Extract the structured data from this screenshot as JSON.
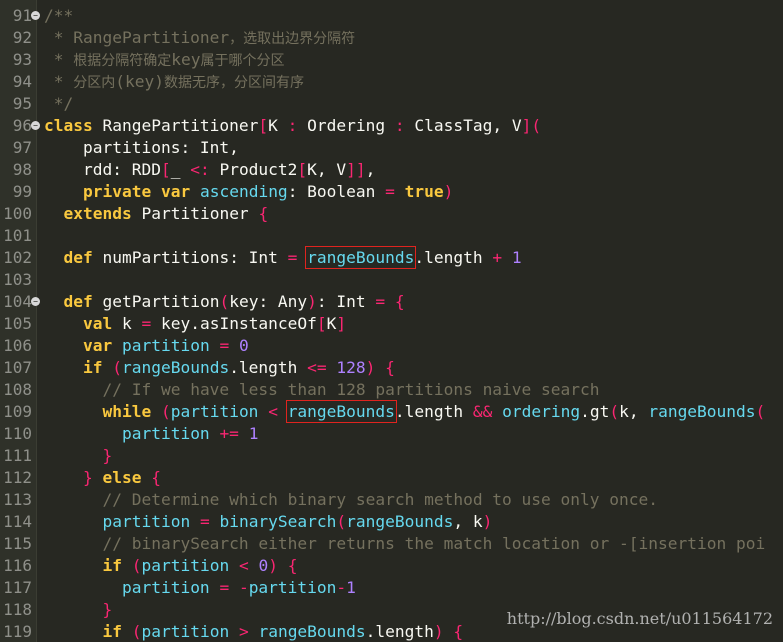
{
  "lines": [
    {
      "n": "91",
      "fold": true,
      "html": "<span class=\"cm\">/**</span>"
    },
    {
      "n": "92",
      "html": "<span class=\"cm\"> * RangePartitioner<span class=\"zh\">，选取出边界分隔符</span></span>"
    },
    {
      "n": "93",
      "html": "<span class=\"cm\"> * <span class=\"zh\">根据分隔符确定</span>key<span class=\"zh\">属于哪个分区</span></span>"
    },
    {
      "n": "94",
      "html": "<span class=\"cm\"> * <span class=\"zh\">分区内</span>(key)<span class=\"zh\">数据无序，分区间有序</span></span>"
    },
    {
      "n": "95",
      "html": "<span class=\"cm\"> */</span>"
    },
    {
      "n": "96",
      "fold": true,
      "html": "<span class=\"kw\">class</span> RangePartitioner<span class=\"op\">[</span>K <span class=\"op\">:</span> Ordering <span class=\"op\">:</span> ClassTag, V<span class=\"op\">](</span>"
    },
    {
      "n": "97",
      "html": "    partitions: Int,"
    },
    {
      "n": "98",
      "html": "    rdd: RDD<span class=\"op\">[</span>_ <span class=\"op\">&lt;:</span> Product2<span class=\"op\">[</span>K, V<span class=\"op\">]]</span>,"
    },
    {
      "n": "99",
      "html": "    <span class=\"kw\">private</span> <span class=\"kw\">var</span> <span class=\"id\">ascending</span>: Boolean <span class=\"op\">=</span> <span class=\"kw\">true</span><span class=\"op\">)</span>"
    },
    {
      "n": "100",
      "html": "  <span class=\"kw\">extends</span> Partitioner <span class=\"op\">{</span>"
    },
    {
      "n": "101",
      "html": ""
    },
    {
      "n": "102",
      "html": "  <span class=\"kw\">def</span> numPartitions: Int <span class=\"op\">=</span> <span class=\"id hl\" data-name=\"highlighted-rangeBounds\">rangeBounds</span>.length <span class=\"op\">+</span> <span class=\"num\">1</span>"
    },
    {
      "n": "103",
      "html": ""
    },
    {
      "n": "104",
      "fold": true,
      "html": "  <span class=\"kw\">def</span> getPartition<span class=\"op\">(</span>key: Any<span class=\"op\">)</span>: Int <span class=\"op\">= {</span>"
    },
    {
      "n": "105",
      "html": "    <span class=\"kw\">val</span> k <span class=\"op\">=</span> key.asInstanceOf<span class=\"op\">[</span>K<span class=\"op\">]</span>"
    },
    {
      "n": "106",
      "html": "    <span class=\"kw\">var</span> <span class=\"id\">partition</span> <span class=\"op\">=</span> <span class=\"num\">0</span>"
    },
    {
      "n": "107",
      "html": "    <span class=\"kw\">if</span> <span class=\"op\">(</span><span class=\"id\">rangeBounds</span>.length <span class=\"op\">&lt;=</span> <span class=\"num\">128</span><span class=\"op\">) {</span>"
    },
    {
      "n": "108",
      "html": "      <span class=\"cm\">// If we have less than 128 partitions naive search</span>"
    },
    {
      "n": "109",
      "html": "      <span class=\"kw\">while</span> <span class=\"op\">(</span><span class=\"id\">partition</span> <span class=\"op\">&lt;</span> <span class=\"id hl\" data-name=\"highlighted-rangeBounds\">rangeBounds</span>.length <span class=\"op\">&amp;&amp;</span> <span class=\"id\">ordering</span>.gt<span class=\"op\">(</span>k, <span class=\"id\">rangeBounds</span><span class=\"op\">(</span>"
    },
    {
      "n": "110",
      "html": "        <span class=\"id\">partition</span> <span class=\"op\">+=</span> <span class=\"num\">1</span>"
    },
    {
      "n": "111",
      "html": "      <span class=\"op\">}</span>"
    },
    {
      "n": "112",
      "html": "    <span class=\"op\">}</span> <span class=\"kw\">else</span> <span class=\"op\">{</span>"
    },
    {
      "n": "113",
      "html": "      <span class=\"cm\">// Determine which binary search method to use only once.</span>"
    },
    {
      "n": "114",
      "html": "      <span class=\"id\">partition</span> <span class=\"op\">=</span> <span class=\"id\">binarySearch</span><span class=\"op\">(</span><span class=\"id\">rangeBounds</span>, k<span class=\"op\">)</span>"
    },
    {
      "n": "115",
      "html": "      <span class=\"cm\">// binarySearch either returns the match location or -[insertion poi</span>"
    },
    {
      "n": "116",
      "html": "      <span class=\"kw\">if</span> <span class=\"op\">(</span><span class=\"id\">partition</span> <span class=\"op\">&lt;</span> <span class=\"num\">0</span><span class=\"op\">) {</span>"
    },
    {
      "n": "117",
      "html": "        <span class=\"id\">partition</span> <span class=\"op\">=</span> <span class=\"op\">-</span><span class=\"id\">partition</span><span class=\"op\">-</span><span class=\"num\">1</span>"
    },
    {
      "n": "118",
      "html": "      <span class=\"op\">}</span>"
    },
    {
      "n": "119",
      "html": "      <span class=\"kw\">if</span> <span class=\"op\">(</span><span class=\"id\">partition</span> <span class=\"op\">&gt;</span> <span class=\"id\">rangeBounds</span>.length<span class=\"op\">) {</span>"
    }
  ],
  "watermark": "http://blog.csdn.net/u011564172",
  "colors": {
    "background": "#272822",
    "comment": "#75715e",
    "keyword": "#f9c83f",
    "identifier": "#66d9ef",
    "operator": "#f92672",
    "number": "#ae81ff",
    "highlight_box": "#e0241f"
  },
  "icons": {
    "fold": "fold-collapse-icon"
  }
}
